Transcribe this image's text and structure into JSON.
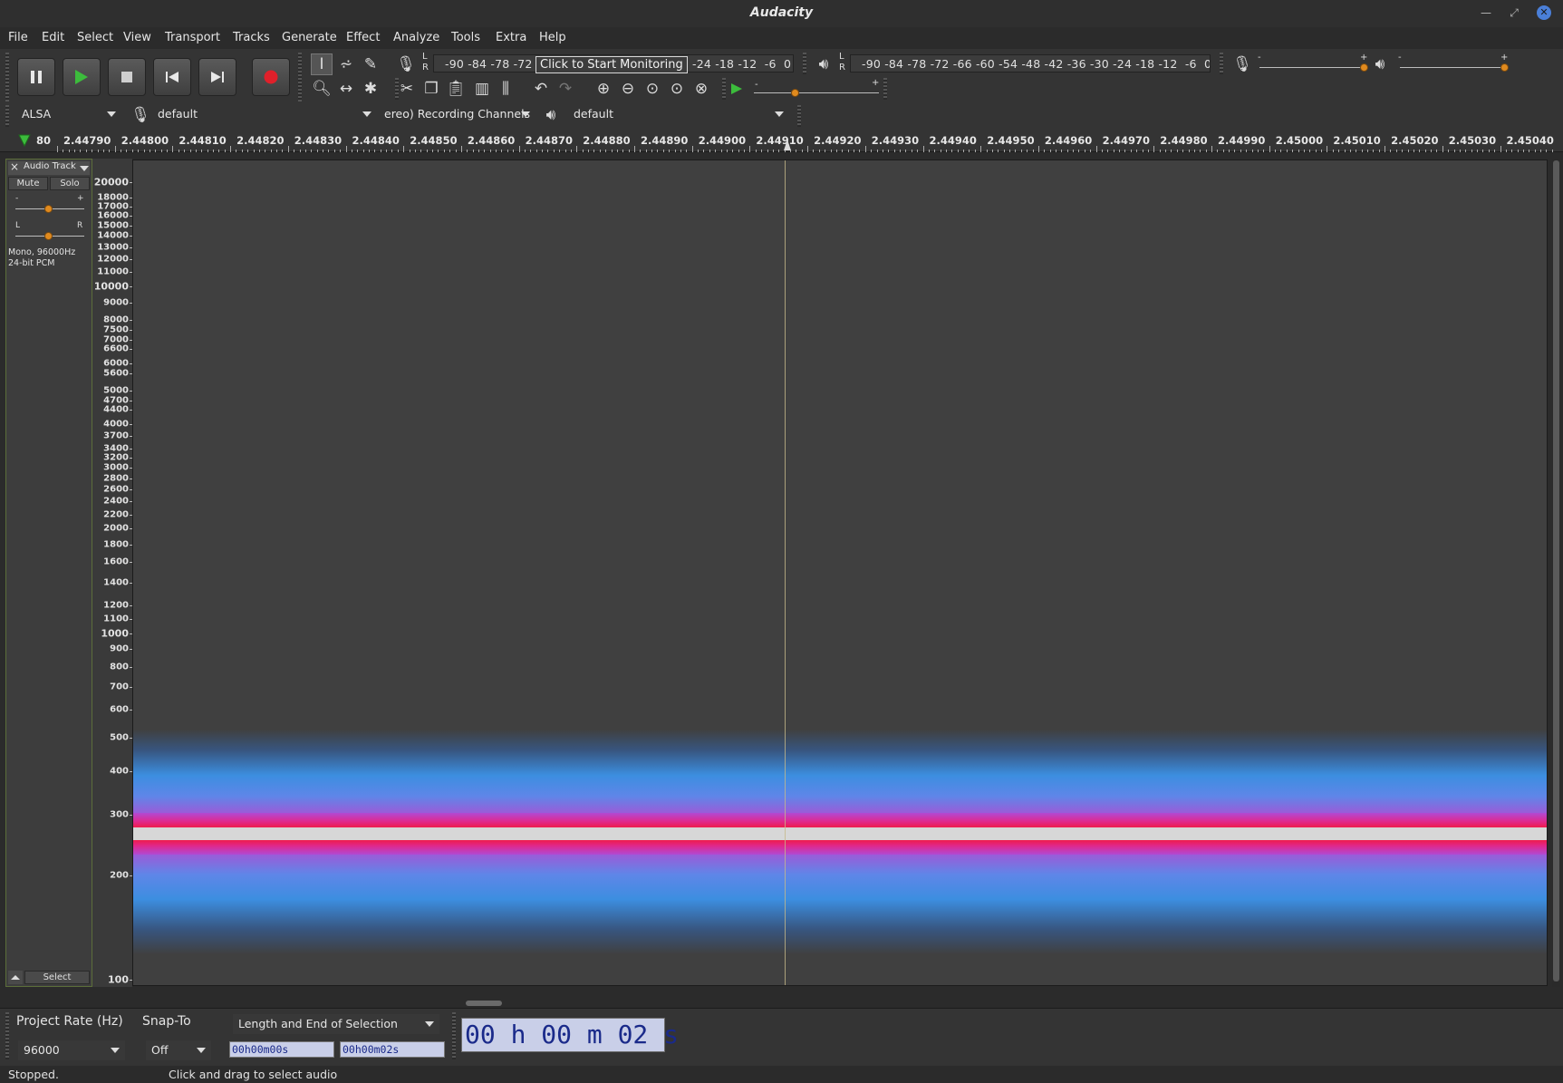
{
  "window": {
    "title": "Audacity"
  },
  "menu": [
    "File",
    "Edit",
    "Select",
    "View",
    "Transport",
    "Tracks",
    "Generate",
    "Effect",
    "Analyze",
    "Tools",
    "Extra",
    "Help"
  ],
  "record_meter": {
    "left_label": "L",
    "right_label": "R",
    "scale_left": "-90 -84 -78 -72",
    "scale_right": "-24 -18 -12  -6  0",
    "tooltip": "Click to Start Monitoring"
  },
  "play_meter": {
    "left_label": "L",
    "right_label": "R",
    "scale": "-90 -84 -78 -72 -66 -60 -54 -48 -42 -36 -30 -24 -18 -12  -6  0"
  },
  "mixer": {
    "minus": "-",
    "plus": "+"
  },
  "play_at_speed": {
    "minus": "-",
    "plus": "+"
  },
  "device": {
    "host": "ALSA",
    "recording_device": "default",
    "channels": "ereo) Recording Channels",
    "playback_device": "default"
  },
  "timeline": {
    "first_label": "80",
    "labels": [
      "2.44790",
      "2.44800",
      "2.44810",
      "2.44820",
      "2.44830",
      "2.44840",
      "2.44850",
      "2.44860",
      "2.44870",
      "2.44880",
      "2.44890",
      "2.44900",
      "2.44910",
      "2.44920",
      "2.44930",
      "2.44940",
      "2.44950",
      "2.44960",
      "2.44970",
      "2.44980",
      "2.44990",
      "2.45000",
      "2.45010",
      "2.45020",
      "2.45030",
      "2.45040"
    ]
  },
  "track": {
    "name": "Audio Track",
    "close": "×",
    "mute": "Mute",
    "solo": "Solo",
    "gain_minus": "-",
    "gain_plus": "+",
    "pan_left": "L",
    "pan_right": "R",
    "format_line1": "Mono, 96000Hz",
    "format_line2": "24-bit PCM",
    "select": "Select"
  },
  "freq_axis": {
    "labels": [
      "20000",
      "18000",
      "17000",
      "16000",
      "15000",
      "14000",
      "13000",
      "12000",
      "11000",
      "10000",
      "9000",
      "8000",
      "7500",
      "7000",
      "6600",
      "6000",
      "5600",
      "5000",
      "4700",
      "4400",
      "4000",
      "3700",
      "3400",
      "3200",
      "3000",
      "2800",
      "2600",
      "2400",
      "2200",
      "2000",
      "1800",
      "1600",
      "1400",
      "1200",
      "1100",
      "1000",
      "900",
      "800",
      "700",
      "600",
      "500",
      "400",
      "300",
      "200",
      "100"
    ]
  },
  "selection_toolbar": {
    "project_rate_label": "Project Rate (Hz)",
    "snap_to_label": "Snap-To",
    "selection_mode": "Length and End of Selection",
    "project_rate": "96000",
    "snap_to": "Off",
    "start": "00h00m00s",
    "end": "00h00m02s"
  },
  "audio_position": "00 h 00 m 02 s",
  "status": {
    "state": "Stopped.",
    "hint": "Click and drag to select audio"
  },
  "colors": {
    "accent_knob": "#e08a1e",
    "record_red": "#e0202a",
    "play_green": "#3cbc3c",
    "time_text": "#1a2a8a"
  }
}
